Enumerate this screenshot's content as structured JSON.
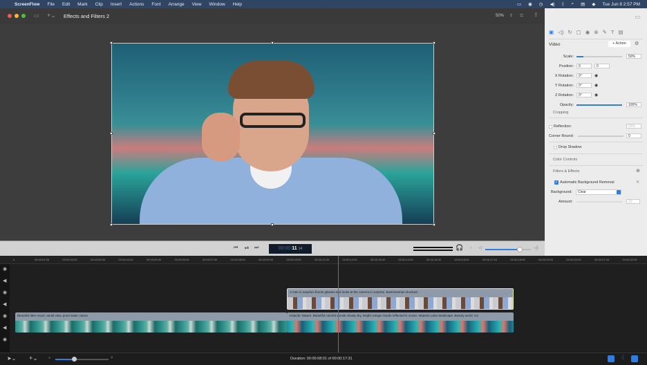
{
  "menubar": {
    "app": "ScreenFlow",
    "items": [
      "File",
      "Edit",
      "Mark",
      "Clip",
      "Insert",
      "Actions",
      "Font",
      "Arrange",
      "View",
      "Window",
      "Help"
    ],
    "datetime": "Tue Jun 8  2:57 PM"
  },
  "toolbar": {
    "title": "Effects and Filters 2",
    "zoom": "50%"
  },
  "panel": {
    "section": "Video",
    "action_label": "+ Action",
    "scale_label": "Scale:",
    "scale_value": "50%",
    "scale_fraction": 0.5,
    "position_label": "Position:",
    "position_x": "0",
    "position_y": "0",
    "x_rotation_label": "X Rotation:",
    "x_rotation": "0°",
    "y_rotation_label": "Y Rotation:",
    "y_rotation": "0°",
    "z_rotation_label": "Z Rotation:",
    "z_rotation": "0°",
    "opacity_label": "Opacity:",
    "opacity_value": "100%",
    "cropping": "Cropping",
    "reflection_label": "Reflection:",
    "reflection_value": "50%",
    "corner_round_label": "Corner Round:",
    "corner_round_value": "0",
    "drop_shadow": "Drop Shadow",
    "color_controls": "Color Controls",
    "filters_effects": "Filters & Effects",
    "filter_name": "Automatic Background Removal",
    "background_label": "Background:",
    "background_value": "Clear",
    "amount_label": "Amount:",
    "amount_value": "10"
  },
  "transport": {
    "timecode_dim": "00:00:",
    "timecode_bright": "11",
    "timecode_frames": "14",
    "volume_fraction": 0.75
  },
  "ruler": {
    "ticks": [
      "0",
      "00:00:01:00",
      "00:00:02:00",
      "00:00:03:00",
      "00:00:04:00",
      "00:00:05:00",
      "00:00:06:00",
      "00:00:07:00",
      "00:00:08:00",
      "00:00:09:00",
      "00:00:10:00",
      "00:00:11:00",
      "00:00:12:00",
      "00:00:13:00",
      "00:00:14:00",
      "00:00:15:00",
      "00:00:16:00",
      "00:00:17:00",
      "00:00:18:00",
      "00:00:19:00",
      "00:00:20:00",
      "00:00:21:00",
      "00:00:22:00"
    ]
  },
  "clips": {
    "top": "A man in surprise shoots glasses and looks at the camera in surprise. Businessman shocked.",
    "lake": "Beautiful lake resort, aerial view, pond water nature",
    "antarctic": "Antarctic Nature. Beautiful colorful sunset cloudy sky. Bright orange clouds reflected in ocean. Majestic polar landscape. Beauty world. Ice"
  },
  "bottombar": {
    "duration": "Duration: 00:00:08:01 of 00:00:17:31",
    "zoom_fraction": 0.35
  },
  "colors": {
    "accent": "#2f7de1",
    "playhead": "#c0503a",
    "menubar": "#2f4563"
  }
}
